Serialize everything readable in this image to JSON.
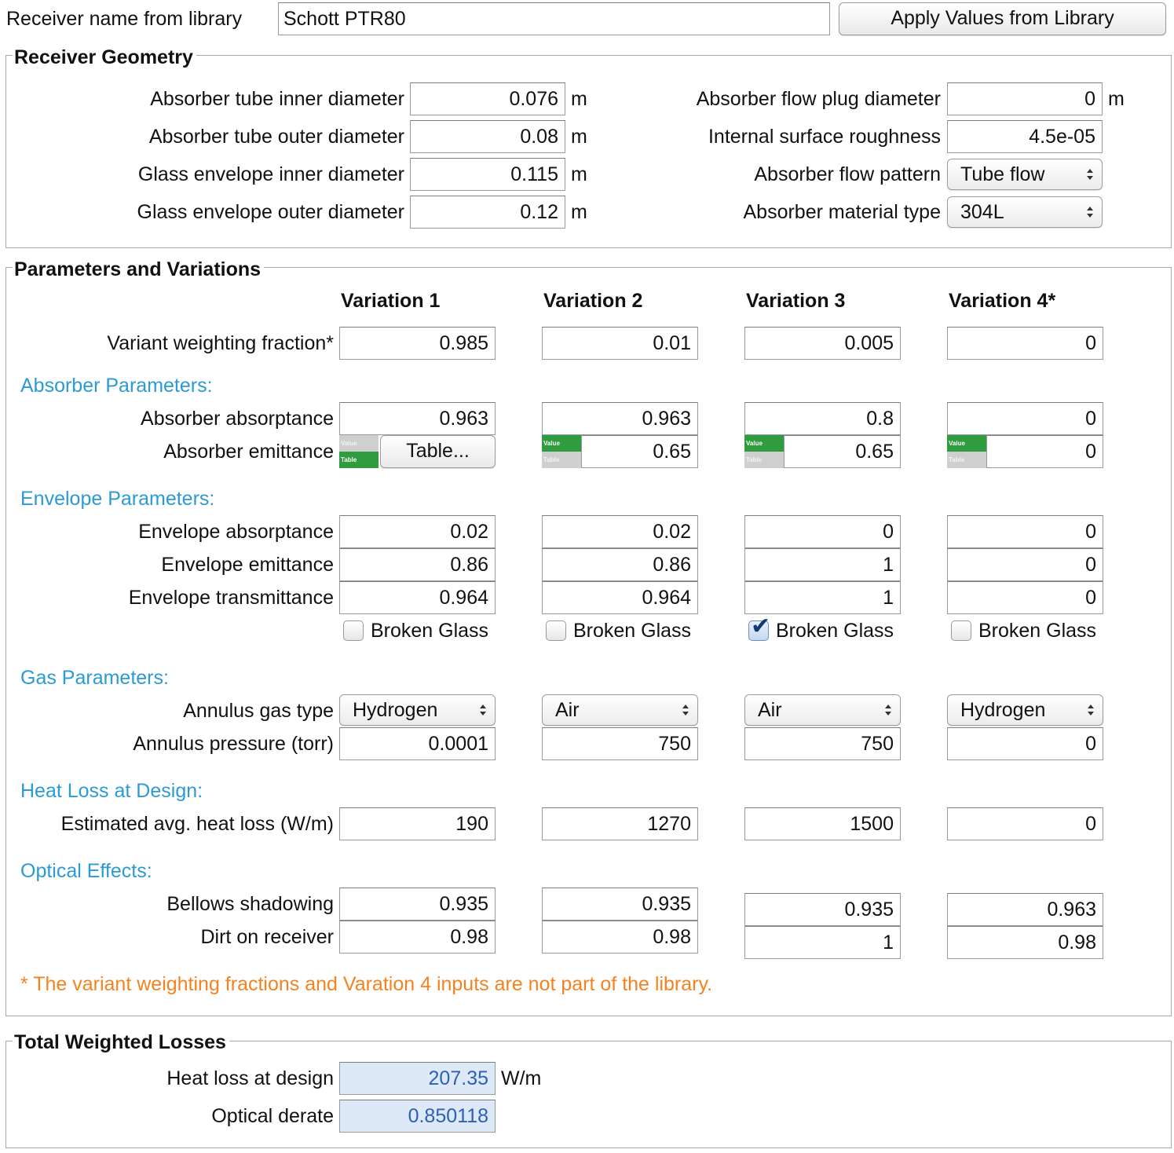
{
  "top": {
    "receiver_label": "Receiver name from library",
    "receiver_value": "Schott PTR80",
    "apply_button": "Apply Values from Library"
  },
  "geometry": {
    "title": "Receiver Geometry",
    "inner_diam_label": "Absorber tube inner diameter",
    "inner_diam_value": "0.076",
    "outer_diam_label": "Absorber tube outer diameter",
    "outer_diam_value": "0.08",
    "glass_inner_label": "Glass envelope inner diameter",
    "glass_inner_value": "0.115",
    "glass_outer_label": "Glass envelope outer diameter",
    "glass_outer_value": "0.12",
    "plug_label": "Absorber flow plug diameter",
    "plug_value": "0",
    "roughness_label": "Internal surface roughness",
    "roughness_value": "4.5e-05",
    "flow_label": "Absorber flow pattern",
    "flow_value": "Tube flow",
    "material_label": "Absorber material type",
    "material_value": "304L",
    "unit_m": "m"
  },
  "params": {
    "title": "Parameters and Variations",
    "columns": [
      "Variation 1",
      "Variation 2",
      "Variation 3",
      "Variation 4*"
    ],
    "weighting_label": "Variant weighting fraction*",
    "weighting": [
      "0.985",
      "0.01",
      "0.005",
      "0"
    ],
    "absorber_section": "Absorber Parameters:",
    "absorptance_label": "Absorber absorptance",
    "absorptance": [
      "0.963",
      "0.963",
      "0.8",
      "0"
    ],
    "emittance_label": "Absorber emittance",
    "emittance_table_button": "Table...",
    "emittance": [
      "",
      "0.65",
      "0.65",
      "0"
    ],
    "toggle_value_label": "Value",
    "toggle_table_label": "Table",
    "envelope_section": "Envelope Parameters:",
    "env_absorptance_label": "Envelope absorptance",
    "env_absorptance": [
      "0.02",
      "0.02",
      "0",
      "0"
    ],
    "env_emittance_label": "Envelope emittance",
    "env_emittance": [
      "0.86",
      "0.86",
      "1",
      "0"
    ],
    "env_transmittance_label": "Envelope transmittance",
    "env_transmittance": [
      "0.964",
      "0.964",
      "1",
      "0"
    ],
    "broken_glass_label": "Broken Glass",
    "broken_glass": [
      false,
      false,
      true,
      false
    ],
    "gas_section": "Gas Parameters:",
    "gas_type_label": "Annulus gas type",
    "gas_type": [
      "Hydrogen",
      "Air",
      "Air",
      "Hydrogen"
    ],
    "pressure_label": "Annulus pressure (torr)",
    "pressure": [
      "0.0001",
      "750",
      "750",
      "0"
    ],
    "heatloss_section": "Heat Loss at Design:",
    "heatloss_label": "Estimated avg. heat loss (W/m)",
    "heatloss": [
      "190",
      "1270",
      "1500",
      "0"
    ],
    "optical_section": "Optical Effects:",
    "bellows_label": "Bellows shadowing",
    "bellows": [
      "0.935",
      "0.935",
      "0.935",
      "0.963"
    ],
    "dirt_label": "Dirt on receiver",
    "dirt": [
      "0.98",
      "0.98",
      "1",
      "0.98"
    ],
    "footnote": "* The variant weighting fractions and Varation 4 inputs are not part of the library."
  },
  "totals": {
    "title": "Total Weighted Losses",
    "heat_label": "Heat loss at design",
    "heat_value": "207.35",
    "heat_unit": "W/m",
    "optical_label": "Optical derate",
    "optical_value": "0.850118"
  },
  "colors": {
    "section_blue": "#2b9ad6",
    "note_orange": "#f5821f",
    "toggle_green": "#2e9c3f",
    "readonly_bg": "#dde9f7",
    "readonly_text": "#2d5fb8"
  }
}
